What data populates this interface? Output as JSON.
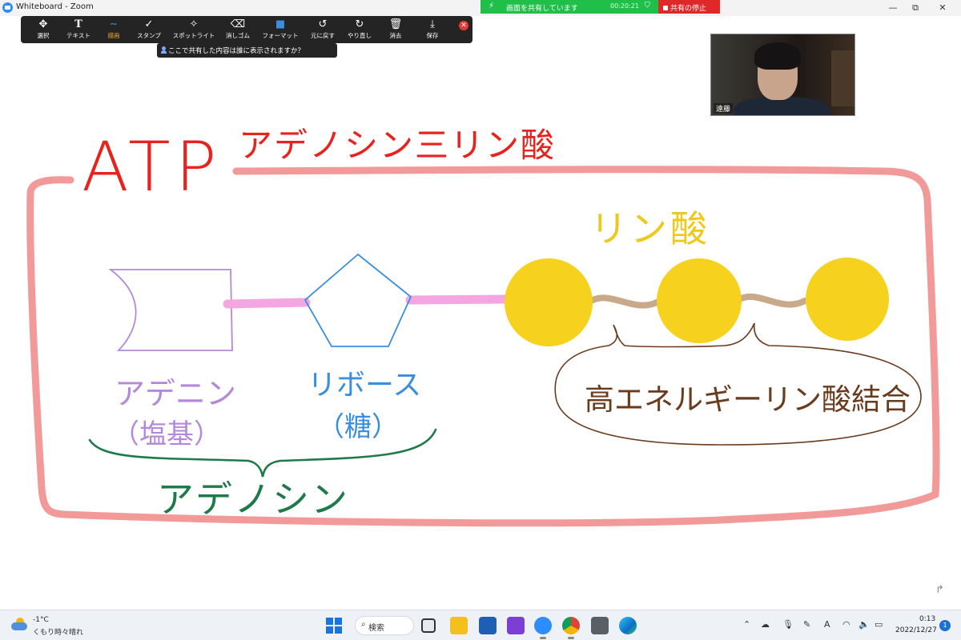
{
  "window": {
    "title": "Whiteboard - Zoom",
    "controls": {
      "minimize": "—",
      "restore": "⧉",
      "close": "✕"
    }
  },
  "share_banner": {
    "text": "画面を共有しています",
    "timer": "00:20:21",
    "stop_label": "共有の停止",
    "color": "#1fbf4a",
    "stop_color": "#e02828"
  },
  "toolbar": {
    "tools": [
      {
        "label": "選択",
        "icon": "move-icon",
        "glyph": "✥"
      },
      {
        "label": "テキスト",
        "icon": "text-icon",
        "glyph": "T"
      },
      {
        "label": "描画",
        "icon": "draw-icon",
        "glyph": "∼",
        "active": true
      },
      {
        "label": "スタンプ",
        "icon": "checkmark-icon",
        "glyph": "✓"
      },
      {
        "label": "スポットライト",
        "icon": "wand-icon",
        "glyph": "✧"
      },
      {
        "label": "消しゴム",
        "icon": "eraser-icon",
        "glyph": "⌫"
      },
      {
        "label": "フォーマット",
        "icon": "format-icon",
        "glyph": "■"
      },
      {
        "label": "元に戻す",
        "icon": "undo-icon",
        "glyph": "↺"
      },
      {
        "label": "やり直し",
        "icon": "redo-icon",
        "glyph": "↻"
      },
      {
        "label": "消去",
        "icon": "trash-icon",
        "glyph": "🗑"
      },
      {
        "label": "保存",
        "icon": "save-icon",
        "glyph": "⤓"
      }
    ],
    "share_tip": "ここで共有した内容は誰に表示されますか？"
  },
  "video": {
    "participant_name": "遠藤"
  },
  "board": {
    "title_atp": "ATP",
    "title_jp": "アデノシン三リン酸",
    "phosphate_label": "リン酸",
    "adenine_label": "アデニン",
    "adenine_sub": "（塩基）",
    "ribose_label": "リボース",
    "ribose_sub": "（糖）",
    "adenosine_label": "アデノシン",
    "bond_label": "高エネルギーリン酸結合",
    "colors": {
      "red": "#e8231e",
      "pink_border": "#f29a9a",
      "purple": "#b38ad9",
      "blue": "#3a8ee0",
      "green": "#1f7a4a",
      "yellow": "#f6d21f",
      "brown": "#6b3b1e",
      "tan_bond": "#c8a989",
      "pink_link": "#f3a6df"
    }
  },
  "taskbar": {
    "temperature": "-1°C",
    "weather": "くもり時々晴れ",
    "search_label": "検索",
    "time": "0:13",
    "date": "2022/12/27",
    "notification_count": "1",
    "input_mode": "A"
  }
}
